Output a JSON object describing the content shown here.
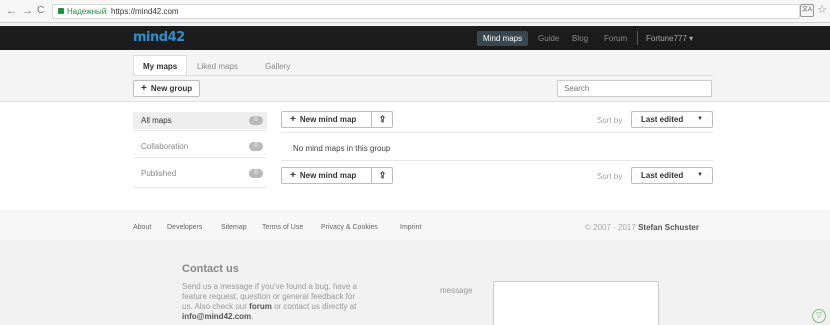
{
  "browser": {
    "secure_label": "Надежный",
    "separator": "|",
    "url": "https://mind42.com",
    "back_icon": "←",
    "forward_icon": "→",
    "reload_icon": "C",
    "translate_icon": "文A",
    "star_icon": "☆"
  },
  "navbar": {
    "logo": "mind42",
    "items": [
      "Mind maps",
      "Guide",
      "Blog",
      "Forum"
    ],
    "user": "Fortune777 ▾"
  },
  "tabs": [
    "My maps",
    "Liked maps",
    "Gallery"
  ],
  "new_group_label": "New group",
  "search": {
    "placeholder": "Search"
  },
  "sidebar": [
    {
      "label": "All maps",
      "count": "0"
    },
    {
      "label": "Collaboration",
      "count": "0"
    },
    {
      "label": "Published",
      "count": "0"
    }
  ],
  "new_mind_map_label": "New mind map",
  "sort_by_label": "Sort by",
  "sort_value": "Last edited",
  "empty_message": "No mind maps in this group",
  "footer": {
    "links": [
      "About",
      "Developers",
      "Sitemap",
      "Terms of Use",
      "Privacy & Cookies",
      "Imprint"
    ],
    "copyright_prefix": "© 2007 - 2017",
    "copyright_name": "Stefan Schuster"
  },
  "contact": {
    "title": "Contact us",
    "text_1": "Send us a message if you've found a bug, have a feature request, question or general feedback for us. Also check our",
    "forum": "forum",
    "text_2": "or contact us directly at",
    "email": "info@mind42.com",
    "text_3": ".",
    "message_label": "message"
  },
  "colors": {
    "navbar": "#1c1c1c",
    "logo": "#2a8fcc",
    "secure": "#1e8e3e"
  }
}
